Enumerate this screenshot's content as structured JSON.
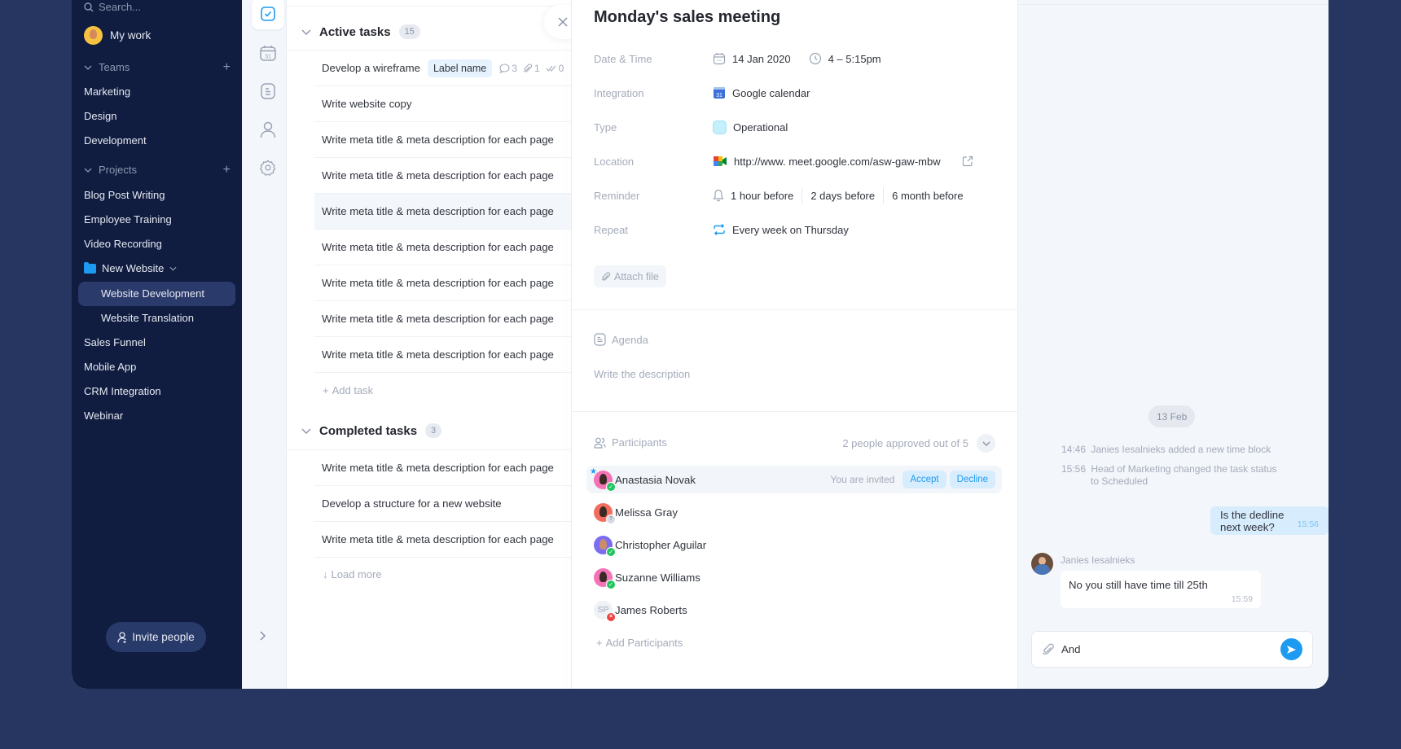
{
  "sidebar": {
    "search_placeholder": "Search...",
    "my_work": "My work",
    "teams_label": "Teams",
    "teams": [
      "Marketing",
      "Design",
      "Development"
    ],
    "projects_label": "Projects",
    "projects": [
      "Blog Post Writing",
      "Employee Training",
      "Video Recording"
    ],
    "folder": "New Website",
    "folder_items": [
      "Website Development",
      "Website Translation"
    ],
    "active_item": "Website Development",
    "projects_after": [
      "Sales Funnel",
      "Mobile App",
      "CRM Integration",
      "Webinar"
    ],
    "invite_button": "Invite people"
  },
  "rail": {
    "icons": [
      "tasks-icon",
      "calendar-icon",
      "notes-icon",
      "user-icon",
      "settings-icon"
    ],
    "calendar_day": "31"
  },
  "tasks": {
    "active": {
      "title": "Active tasks",
      "count": "15",
      "rows": [
        {
          "name": "Develop a wireframe",
          "label": "Label name",
          "comments": "3",
          "attachments": "1",
          "checks": "0"
        },
        {
          "name": "Write website copy"
        },
        {
          "name": "Write meta title & meta description for each page"
        },
        {
          "name": "Write meta title & meta description for each page"
        },
        {
          "name": "Write meta title & meta description for each page"
        },
        {
          "name": "Write meta title & meta description for each page"
        },
        {
          "name": "Write meta title & meta description for each page"
        },
        {
          "name": "Write meta title & meta description for each page"
        },
        {
          "name": "Write meta title & meta description for each page"
        }
      ],
      "add_task": "Add task"
    },
    "completed": {
      "title": "Completed tasks",
      "count": "3",
      "rows": [
        {
          "name": "Write meta title & meta description for each page"
        },
        {
          "name": "Develop a structure for a new website"
        },
        {
          "name": "Write meta title & meta description for each page"
        }
      ],
      "load_more": "Load more"
    }
  },
  "detail": {
    "title": "Monday's sales meeting",
    "fields": {
      "date_time": {
        "label": "Date & Time",
        "date": "14 Jan 2020",
        "time": "4 – 5:15pm"
      },
      "integration": {
        "label": "Integration",
        "value": "Google calendar",
        "icon_day": "31"
      },
      "type": {
        "label": "Type",
        "value": "Operational",
        "color": "#c4f0fb"
      },
      "location": {
        "label": "Location",
        "value": "http://www. meet.google.com/asw-gaw-mbw"
      },
      "reminder": {
        "label": "Reminder",
        "values": [
          "1 hour before",
          "2 days before",
          "6 month before"
        ]
      },
      "repeat": {
        "label": "Repeat",
        "value": "Every week on Thursday"
      }
    },
    "attach_file": "Attach file",
    "agenda": {
      "title": "Agenda",
      "placeholder": "Write the description"
    },
    "participants": {
      "title": "Participants",
      "summary": "2 people approved out of 5",
      "list": [
        {
          "name": "Anastasia Novak",
          "status": "approved",
          "color": "#f472b6",
          "invited_text": "You are invited",
          "accept": "Accept",
          "decline": "Decline"
        },
        {
          "name": "Melissa Gray",
          "status": "pending",
          "color": "#f26d5f"
        },
        {
          "name": "Christopher Aguilar",
          "status": "approved",
          "color": "#7c6cf2"
        },
        {
          "name": "Suzanne Williams",
          "status": "approved",
          "color": "#f472b6"
        },
        {
          "name": "James Roberts",
          "status": "declined",
          "initials": "SP"
        }
      ],
      "add": "Add Participants"
    }
  },
  "chat": {
    "date_chip": "13 Feb",
    "system_messages": [
      {
        "time": "14:46",
        "text": "Janies Iesalnieks added a new time block"
      },
      {
        "time": "15:56",
        "text": "Head of Marketing changed the task status",
        "text2": "to Scheduled"
      }
    ],
    "outgoing": {
      "text": "Is the dedline next week?",
      "time": "15:56"
    },
    "incoming": {
      "author": "Janies Iesalnieks",
      "text": "No you still have time till 25th",
      "time": "15:59"
    },
    "composer_value": "And "
  },
  "colors": {
    "accent": "#1d9bf0",
    "sidebar_bg": "#101d40",
    "page_bg": "#263661",
    "approved": "#22c55e",
    "declined": "#ef4444"
  }
}
